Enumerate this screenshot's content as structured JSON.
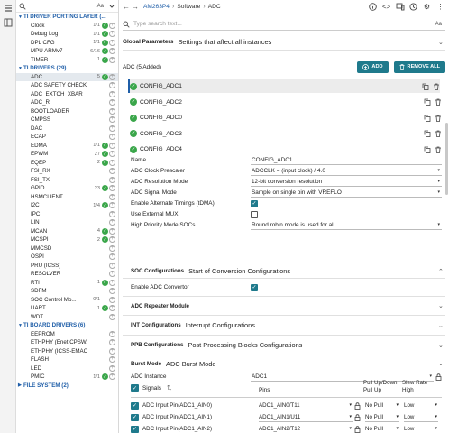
{
  "sidebar": {
    "search_aa": "Aa",
    "categories": [
      {
        "label": "TI DRIVER PORTING LAYER (...",
        "items": [
          {
            "label": "Clock",
            "count": "1/1",
            "ok": true
          },
          {
            "label": "Debug Log",
            "count": "1/1",
            "ok": true
          },
          {
            "label": "DPL CFG",
            "count": "1/1",
            "ok": true
          },
          {
            "label": "MPU ARMv7",
            "count": "6/16",
            "ok": true
          },
          {
            "label": "TIMER",
            "count": "1",
            "ok": true
          }
        ]
      },
      {
        "label": "TI DRIVERS (29)",
        "items": [
          {
            "label": "ADC",
            "count": "5",
            "ok": true,
            "selected": true
          },
          {
            "label": "ADC SAFETY CHECKER",
            "count": "",
            "ok": false
          },
          {
            "label": "ADC_EXTCH_XBAR",
            "count": "",
            "ok": false
          },
          {
            "label": "ADC_R",
            "count": "",
            "ok": false
          },
          {
            "label": "BOOTLOADER",
            "count": "",
            "ok": false
          },
          {
            "label": "CMPSS",
            "count": "",
            "ok": false
          },
          {
            "label": "DAC",
            "count": "",
            "ok": false
          },
          {
            "label": "ECAP",
            "count": "",
            "ok": false
          },
          {
            "label": "EDMA",
            "count": "1/1",
            "ok": true
          },
          {
            "label": "EPWM",
            "count": "27",
            "ok": true
          },
          {
            "label": "EQEP",
            "count": "2",
            "ok": true
          },
          {
            "label": "FSI_RX",
            "count": "",
            "ok": false
          },
          {
            "label": "FSI_TX",
            "count": "",
            "ok": false
          },
          {
            "label": "GPIO",
            "count": "23",
            "ok": true
          },
          {
            "label": "HSMCLIENT",
            "count": "",
            "ok": false
          },
          {
            "label": "I2C",
            "count": "1/4",
            "ok": true
          },
          {
            "label": "IPC",
            "count": "",
            "ok": false
          },
          {
            "label": "LIN",
            "count": "",
            "ok": false
          },
          {
            "label": "MCAN",
            "count": "4",
            "ok": true
          },
          {
            "label": "MCSPI",
            "count": "2",
            "ok": true
          },
          {
            "label": "MMCSD",
            "count": "",
            "ok": false
          },
          {
            "label": "OSPI",
            "count": "",
            "ok": false
          },
          {
            "label": "PRU (ICSS)",
            "count": "",
            "ok": false
          },
          {
            "label": "RESOLVER",
            "count": "",
            "ok": false
          },
          {
            "label": "RTI",
            "count": "1",
            "ok": true
          },
          {
            "label": "SDFM",
            "count": "",
            "ok": false
          },
          {
            "label": "SOC Control Mo...",
            "count": "0/1",
            "ok": false
          },
          {
            "label": "UART",
            "count": "1",
            "ok": true
          },
          {
            "label": "WDT",
            "count": "",
            "ok": false
          }
        ]
      },
      {
        "label": "TI BOARD DRIVERS (6)",
        "items": [
          {
            "label": "EEPROM",
            "count": "",
            "ok": false
          },
          {
            "label": "ETHPHY (Enet CPSW/ICS...",
            "count": "",
            "ok": false
          },
          {
            "label": "ETHPHY (ICSS-EMAC)",
            "count": "",
            "ok": false
          },
          {
            "label": "FLASH",
            "count": "",
            "ok": false
          },
          {
            "label": "LED",
            "count": "",
            "ok": false
          },
          {
            "label": "PMIC",
            "count": "1/1",
            "ok": true
          }
        ]
      },
      {
        "label": "FILE SYSTEM (2)",
        "items": []
      }
    ]
  },
  "topbar": {
    "device": "AM263P4",
    "crumb_sep": "›",
    "crumb1": "Software",
    "crumb2": "ADC"
  },
  "main": {
    "search_placeholder": "Type search text...",
    "search_aa": "Aa",
    "global": {
      "title": "Global Parameters",
      "desc": "Settings that affect all instances"
    },
    "adc_label": "ADC (5 Added)",
    "add_label": "ADD",
    "remove_label": "REMOVE ALL",
    "instances": [
      "CONFIG_ADC1",
      "CONFIG_ADC2",
      "CONFIG_ADC0",
      "CONFIG_ADC3",
      "CONFIG_ADC4"
    ],
    "fields": [
      {
        "label": "Name",
        "value": "CONFIG_ADC1",
        "type": "text"
      },
      {
        "label": "ADC Clock Prescaler",
        "value": "ADCCLK = (input clock) / 4.0",
        "type": "select"
      },
      {
        "label": "ADC Resolution Mode",
        "value": "12-bit conversion resolution",
        "type": "select"
      },
      {
        "label": "ADC Signal Mode",
        "value": "Sample on single pin with VREFLO",
        "type": "select"
      },
      {
        "label": "Enable Alternate Timings (tDMA)",
        "value": true,
        "type": "checkbox"
      },
      {
        "label": "Use External MUX",
        "value": false,
        "type": "checkbox"
      },
      {
        "label": "High Priority Mode SOCs",
        "value": "Round robin mode is used for all",
        "type": "select"
      }
    ],
    "soc": {
      "title": "SOC Configurations",
      "desc": "Start of Conversion Configurations"
    },
    "enable_adc": {
      "label": "Enable ADC Convertor",
      "value": true
    },
    "repeater": {
      "title": "ADC Repeater Module"
    },
    "int": {
      "title": "INT Configurations",
      "desc": "Interrupt Configurations"
    },
    "ppb": {
      "title": "PPB Configurations",
      "desc": "Post Processing Blocks Configurations"
    },
    "burst": {
      "title": "Burst Mode",
      "desc": "ADC Burst Mode"
    },
    "adc_instance": {
      "label": "ADC Instance",
      "value": "ADC1"
    },
    "table": {
      "col_signals": "Signals",
      "col_pins": "Pins",
      "col_pull": "Pull Up/Down\nPull Up",
      "col_pull1": "Pull Up/Down",
      "col_pull2": "Pull Up",
      "col_slew1": "Slew Rate",
      "col_slew2": "High",
      "rows": [
        {
          "signal": "ADC Input Pin(ADC1_AIN0)",
          "pin": "ADC1_AIN0/T11",
          "pull": "No Pull",
          "slew": "Low"
        },
        {
          "signal": "ADC Input Pin(ADC1_AIN1)",
          "pin": "ADC1_AIN1/U11",
          "pull": "No Pull",
          "slew": "Low"
        },
        {
          "signal": "ADC Input Pin(ADC1_AIN2)",
          "pin": "ADC1_AIN2/T12",
          "pull": "No Pull",
          "slew": "Low"
        },
        {
          "signal": "ADC Input Pin(ADC1_AIN3)",
          "pin": "ADC1_AIN3/V12",
          "pull": "No Pull",
          "slew": "Low"
        }
      ]
    }
  }
}
